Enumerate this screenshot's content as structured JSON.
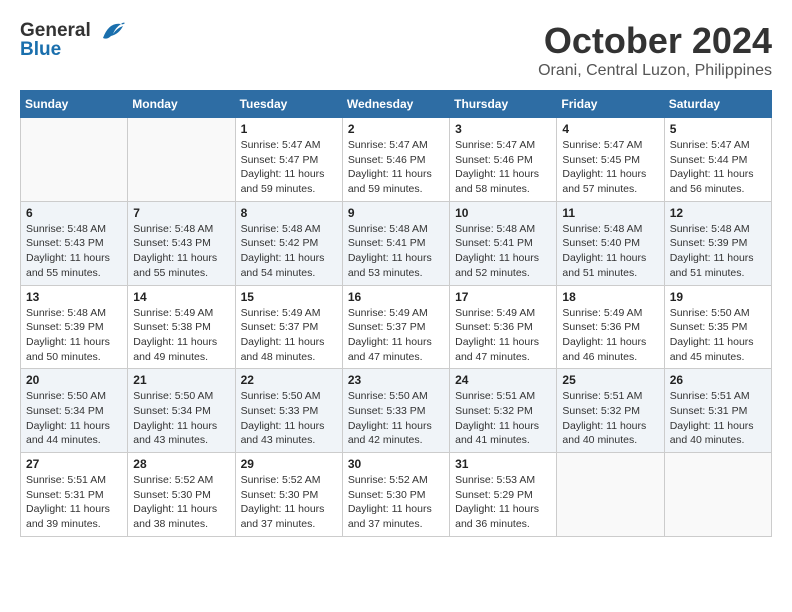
{
  "header": {
    "logo_general": "General",
    "logo_blue": "Blue",
    "month": "October 2024",
    "location": "Orani, Central Luzon, Philippines"
  },
  "weekdays": [
    "Sunday",
    "Monday",
    "Tuesday",
    "Wednesday",
    "Thursday",
    "Friday",
    "Saturday"
  ],
  "weeks": [
    [
      {
        "day": "",
        "sunrise": "",
        "sunset": "",
        "daylight": ""
      },
      {
        "day": "",
        "sunrise": "",
        "sunset": "",
        "daylight": ""
      },
      {
        "day": "1",
        "sunrise": "Sunrise: 5:47 AM",
        "sunset": "Sunset: 5:47 PM",
        "daylight": "Daylight: 11 hours and 59 minutes."
      },
      {
        "day": "2",
        "sunrise": "Sunrise: 5:47 AM",
        "sunset": "Sunset: 5:46 PM",
        "daylight": "Daylight: 11 hours and 59 minutes."
      },
      {
        "day": "3",
        "sunrise": "Sunrise: 5:47 AM",
        "sunset": "Sunset: 5:46 PM",
        "daylight": "Daylight: 11 hours and 58 minutes."
      },
      {
        "day": "4",
        "sunrise": "Sunrise: 5:47 AM",
        "sunset": "Sunset: 5:45 PM",
        "daylight": "Daylight: 11 hours and 57 minutes."
      },
      {
        "day": "5",
        "sunrise": "Sunrise: 5:47 AM",
        "sunset": "Sunset: 5:44 PM",
        "daylight": "Daylight: 11 hours and 56 minutes."
      }
    ],
    [
      {
        "day": "6",
        "sunrise": "Sunrise: 5:48 AM",
        "sunset": "Sunset: 5:43 PM",
        "daylight": "Daylight: 11 hours and 55 minutes."
      },
      {
        "day": "7",
        "sunrise": "Sunrise: 5:48 AM",
        "sunset": "Sunset: 5:43 PM",
        "daylight": "Daylight: 11 hours and 55 minutes."
      },
      {
        "day": "8",
        "sunrise": "Sunrise: 5:48 AM",
        "sunset": "Sunset: 5:42 PM",
        "daylight": "Daylight: 11 hours and 54 minutes."
      },
      {
        "day": "9",
        "sunrise": "Sunrise: 5:48 AM",
        "sunset": "Sunset: 5:41 PM",
        "daylight": "Daylight: 11 hours and 53 minutes."
      },
      {
        "day": "10",
        "sunrise": "Sunrise: 5:48 AM",
        "sunset": "Sunset: 5:41 PM",
        "daylight": "Daylight: 11 hours and 52 minutes."
      },
      {
        "day": "11",
        "sunrise": "Sunrise: 5:48 AM",
        "sunset": "Sunset: 5:40 PM",
        "daylight": "Daylight: 11 hours and 51 minutes."
      },
      {
        "day": "12",
        "sunrise": "Sunrise: 5:48 AM",
        "sunset": "Sunset: 5:39 PM",
        "daylight": "Daylight: 11 hours and 51 minutes."
      }
    ],
    [
      {
        "day": "13",
        "sunrise": "Sunrise: 5:48 AM",
        "sunset": "Sunset: 5:39 PM",
        "daylight": "Daylight: 11 hours and 50 minutes."
      },
      {
        "day": "14",
        "sunrise": "Sunrise: 5:49 AM",
        "sunset": "Sunset: 5:38 PM",
        "daylight": "Daylight: 11 hours and 49 minutes."
      },
      {
        "day": "15",
        "sunrise": "Sunrise: 5:49 AM",
        "sunset": "Sunset: 5:37 PM",
        "daylight": "Daylight: 11 hours and 48 minutes."
      },
      {
        "day": "16",
        "sunrise": "Sunrise: 5:49 AM",
        "sunset": "Sunset: 5:37 PM",
        "daylight": "Daylight: 11 hours and 47 minutes."
      },
      {
        "day": "17",
        "sunrise": "Sunrise: 5:49 AM",
        "sunset": "Sunset: 5:36 PM",
        "daylight": "Daylight: 11 hours and 47 minutes."
      },
      {
        "day": "18",
        "sunrise": "Sunrise: 5:49 AM",
        "sunset": "Sunset: 5:36 PM",
        "daylight": "Daylight: 11 hours and 46 minutes."
      },
      {
        "day": "19",
        "sunrise": "Sunrise: 5:50 AM",
        "sunset": "Sunset: 5:35 PM",
        "daylight": "Daylight: 11 hours and 45 minutes."
      }
    ],
    [
      {
        "day": "20",
        "sunrise": "Sunrise: 5:50 AM",
        "sunset": "Sunset: 5:34 PM",
        "daylight": "Daylight: 11 hours and 44 minutes."
      },
      {
        "day": "21",
        "sunrise": "Sunrise: 5:50 AM",
        "sunset": "Sunset: 5:34 PM",
        "daylight": "Daylight: 11 hours and 43 minutes."
      },
      {
        "day": "22",
        "sunrise": "Sunrise: 5:50 AM",
        "sunset": "Sunset: 5:33 PM",
        "daylight": "Daylight: 11 hours and 43 minutes."
      },
      {
        "day": "23",
        "sunrise": "Sunrise: 5:50 AM",
        "sunset": "Sunset: 5:33 PM",
        "daylight": "Daylight: 11 hours and 42 minutes."
      },
      {
        "day": "24",
        "sunrise": "Sunrise: 5:51 AM",
        "sunset": "Sunset: 5:32 PM",
        "daylight": "Daylight: 11 hours and 41 minutes."
      },
      {
        "day": "25",
        "sunrise": "Sunrise: 5:51 AM",
        "sunset": "Sunset: 5:32 PM",
        "daylight": "Daylight: 11 hours and 40 minutes."
      },
      {
        "day": "26",
        "sunrise": "Sunrise: 5:51 AM",
        "sunset": "Sunset: 5:31 PM",
        "daylight": "Daylight: 11 hours and 40 minutes."
      }
    ],
    [
      {
        "day": "27",
        "sunrise": "Sunrise: 5:51 AM",
        "sunset": "Sunset: 5:31 PM",
        "daylight": "Daylight: 11 hours and 39 minutes."
      },
      {
        "day": "28",
        "sunrise": "Sunrise: 5:52 AM",
        "sunset": "Sunset: 5:30 PM",
        "daylight": "Daylight: 11 hours and 38 minutes."
      },
      {
        "day": "29",
        "sunrise": "Sunrise: 5:52 AM",
        "sunset": "Sunset: 5:30 PM",
        "daylight": "Daylight: 11 hours and 37 minutes."
      },
      {
        "day": "30",
        "sunrise": "Sunrise: 5:52 AM",
        "sunset": "Sunset: 5:30 PM",
        "daylight": "Daylight: 11 hours and 37 minutes."
      },
      {
        "day": "31",
        "sunrise": "Sunrise: 5:53 AM",
        "sunset": "Sunset: 5:29 PM",
        "daylight": "Daylight: 11 hours and 36 minutes."
      },
      {
        "day": "",
        "sunrise": "",
        "sunset": "",
        "daylight": ""
      },
      {
        "day": "",
        "sunrise": "",
        "sunset": "",
        "daylight": ""
      }
    ]
  ]
}
